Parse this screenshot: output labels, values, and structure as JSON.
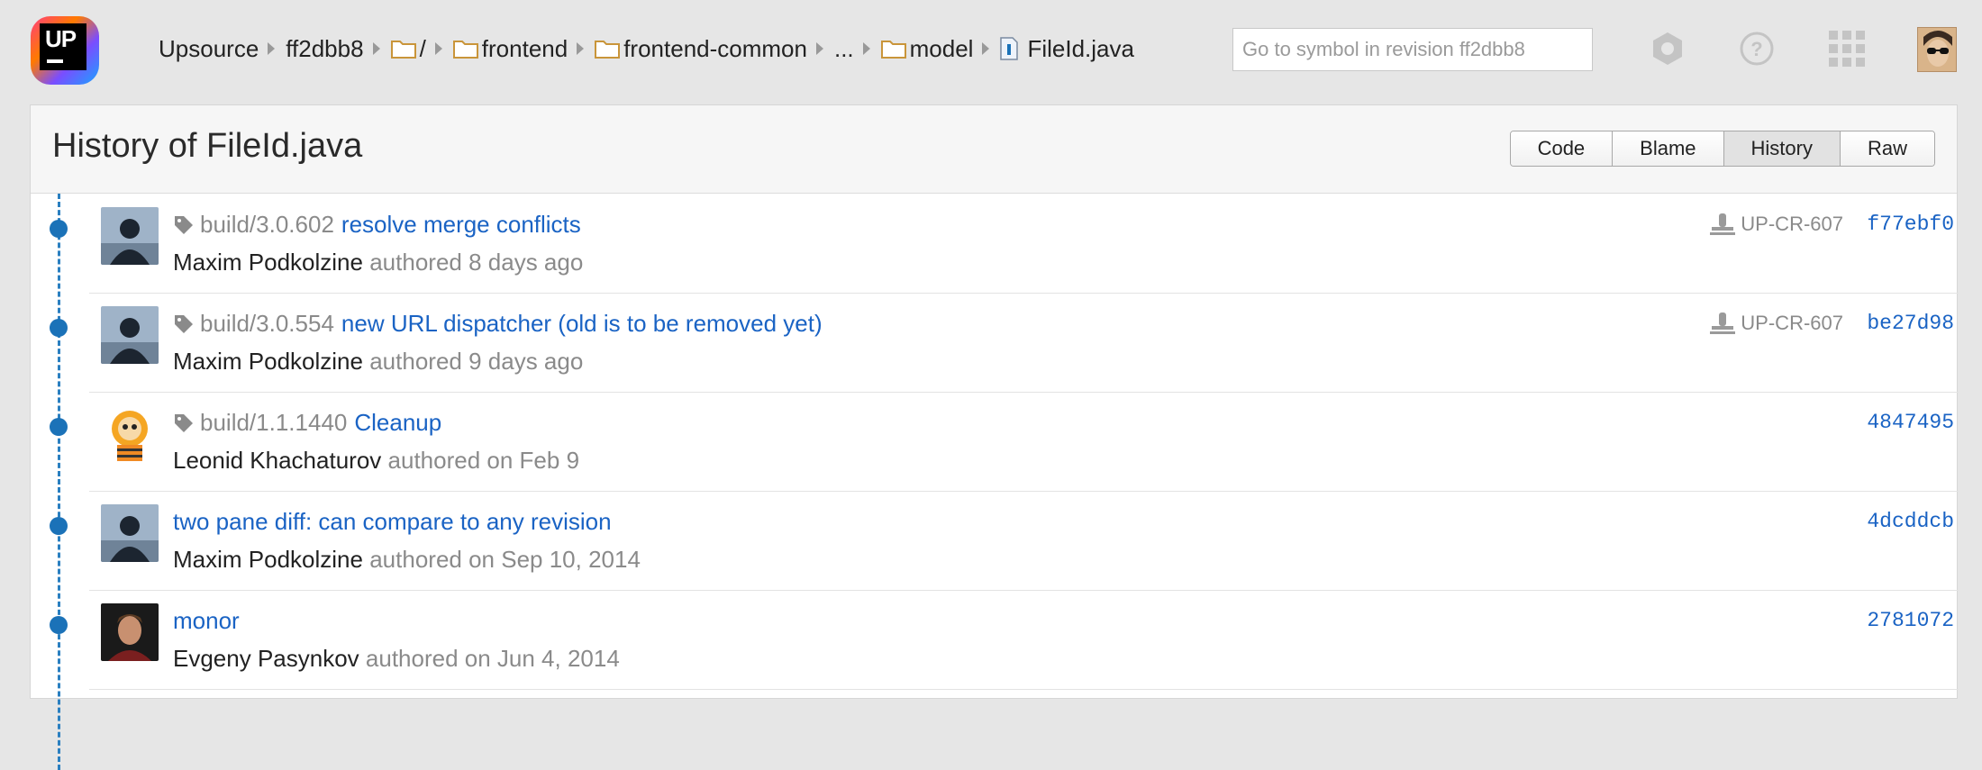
{
  "breadcrumb": {
    "project": "Upsource",
    "revision": "ff2dbb8",
    "root": "/",
    "folder1": "frontend",
    "folder2": "frontend-common",
    "ellipsis": "...",
    "folder3": "model",
    "file": "FileId.java"
  },
  "search": {
    "placeholder": "Go to symbol in revision ff2dbb8"
  },
  "header": {
    "title": "History of FileId.java",
    "tabs": [
      "Code",
      "Blame",
      "History",
      "Raw"
    ],
    "active_tab": "History"
  },
  "commits": [
    {
      "tag": "build/3.0.602",
      "message": "resolve merge conflicts",
      "author": "Maxim Podkolzine",
      "date": "authored 8 days ago",
      "review": "UP-CR-607",
      "hash": "f77ebf0"
    },
    {
      "tag": "build/3.0.554",
      "message": "new URL dispatcher (old is to be removed yet)",
      "author": "Maxim Podkolzine",
      "date": "authored 9 days ago",
      "review": "UP-CR-607",
      "hash": "be27d98"
    },
    {
      "tag": "build/1.1.1440",
      "message": "Cleanup",
      "author": "Leonid Khachaturov",
      "date": "authored on Feb 9",
      "review": "",
      "hash": "4847495"
    },
    {
      "tag": "",
      "message": "two pane diff: can compare to any revision",
      "author": "Maxim Podkolzine",
      "date": "authored on Sep 10, 2014",
      "review": "",
      "hash": "4dcddcb"
    },
    {
      "tag": "",
      "message": "monor",
      "author": "Evgeny Pasynkov",
      "date": "authored on Jun 4, 2014",
      "review": "",
      "hash": "2781072"
    }
  ],
  "colors": {
    "link": "#1a63c4",
    "timeline": "#1b72b8",
    "muted": "#8a8a8a"
  },
  "icons": [
    "upsource-logo",
    "folder-icon",
    "file-icon",
    "settings-icon",
    "help-icon",
    "apps-grid-icon",
    "user-avatar",
    "tag-icon",
    "review-icon"
  ]
}
